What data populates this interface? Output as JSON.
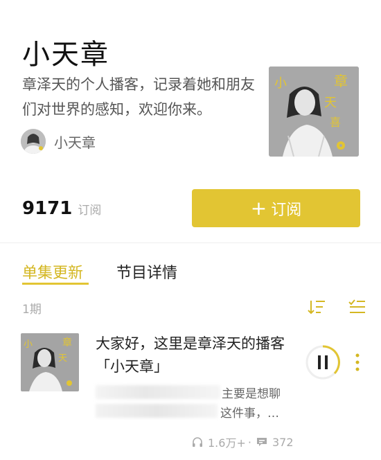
{
  "podcast": {
    "title": "小天章",
    "description": "章泽天的个人播客，记录着她和朋友们对世界的感知，欢迎你来。",
    "author_name": "小天章"
  },
  "subscription": {
    "count": "9171",
    "count_label": "订阅",
    "button_plus": "+",
    "button_label": "订阅"
  },
  "tabs": [
    {
      "label": "单集更新",
      "active": true
    },
    {
      "label": "节目详情",
      "active": false
    }
  ],
  "episode_list": {
    "count_label": "1期",
    "episodes": [
      {
        "title": "大家好，这里是章泽天的播客「小天章」",
        "excerpt_line1": "主要是想聊",
        "excerpt_line2": "这件事，…",
        "plays": "1.6万+",
        "comments": "372"
      }
    ]
  },
  "colors": {
    "accent": "#e2c533",
    "accent_text": "#d4b722"
  },
  "icons": [
    "plus-icon",
    "sort-icon",
    "filter-list-icon",
    "pause-icon",
    "more-vertical-icon",
    "headphones-icon",
    "comment-icon"
  ]
}
